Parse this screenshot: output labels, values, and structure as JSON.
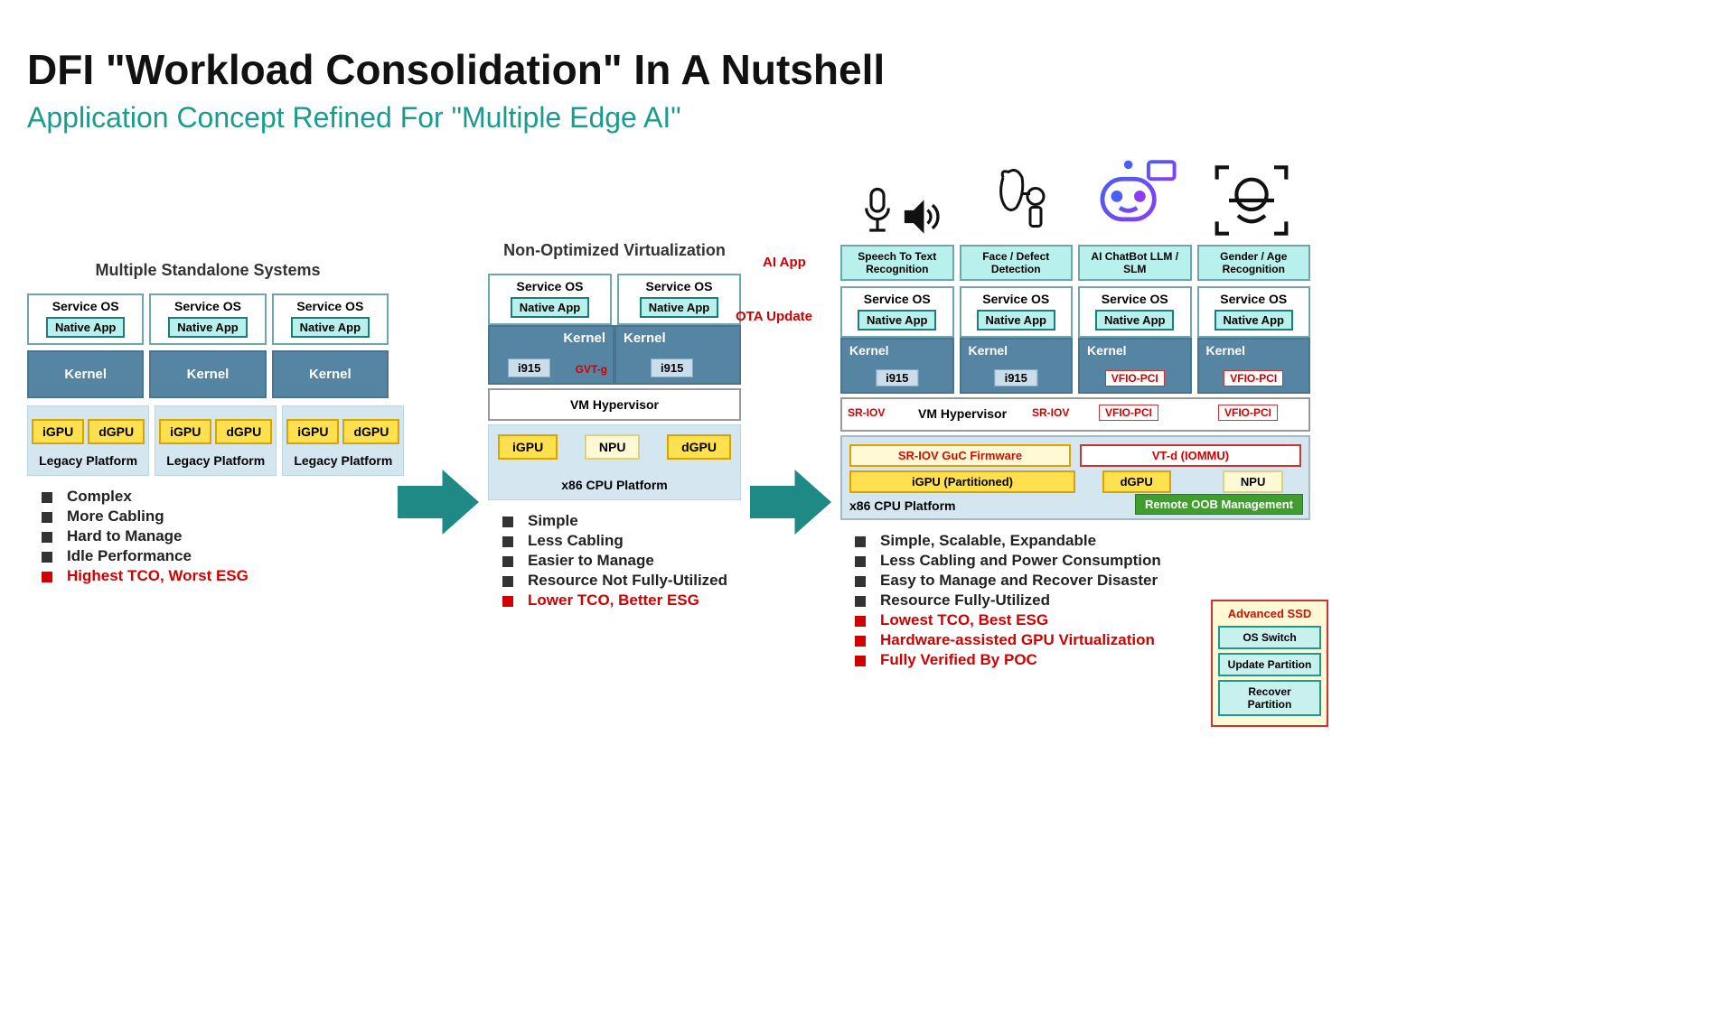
{
  "title": "DFI \"Workload Consolidation\" In A Nutshell",
  "subtitle": "Application Concept Refined For \"Multiple Edge AI\"",
  "col1": {
    "title": "Multiple Standalone Systems",
    "service_os": "Service OS",
    "native_app": "Native App",
    "kernel": "Kernel",
    "igpu": "iGPU",
    "dgpu": "dGPU",
    "legacy": "Legacy Platform",
    "bullets": [
      "Complex",
      "More Cabling",
      "Hard to Manage",
      "Idle Performance"
    ],
    "bullets_red": [
      "Highest TCO, Worst ESG"
    ]
  },
  "col2": {
    "title": "Non-Optimized Virtualization",
    "service_os": "Service OS",
    "native_app": "Native App",
    "kernel": "Kernel",
    "i915": "i915",
    "gvt": "GVT-g",
    "hypervisor": "VM Hypervisor",
    "igpu": "iGPU",
    "npu": "NPU",
    "dgpu": "dGPU",
    "platform": "x86 CPU Platform",
    "bullets": [
      "Simple",
      "Less Cabling",
      "Easier to Manage",
      "Resource Not Fully-Utilized"
    ],
    "bullets_red": [
      "Lower TCO, Better ESG"
    ]
  },
  "col3": {
    "ai_app_label": "AI App",
    "ota_label": "OTA Update",
    "ai_apps": [
      "Speech To Text Recognition",
      "Face / Defect Detection",
      "AI ChatBot LLM / SLM",
      "Gender / Age Recognition"
    ],
    "service_os": "Service OS",
    "native_app": "Native App",
    "kernel": "Kernel",
    "i915": "i915",
    "vfio": "VFIO-PCI",
    "sriov": "SR-IOV",
    "hypervisor": "VM Hypervisor",
    "sriov_fw": "SR-IOV GuC Firmware",
    "vtd": "VT-d (IOMMU)",
    "igpu_part": "iGPU (Partitioned)",
    "dgpu": "dGPU",
    "npu": "NPU",
    "platform": "x86 CPU Platform",
    "oob": "Remote OOB Management",
    "ssd_title": "Advanced SSD",
    "ssd_items": [
      "OS Switch",
      "Update Partition",
      "Recover Partition"
    ],
    "bullets": [
      "Simple, Scalable, Expandable",
      "Less Cabling and Power Consumption",
      "Easy to Manage and Recover Disaster",
      "Resource Fully-Utilized"
    ],
    "bullets_red": [
      "Lowest TCO, Best ESG",
      "Hardware-assisted GPU Virtualization",
      "Fully Verified By POC"
    ]
  }
}
